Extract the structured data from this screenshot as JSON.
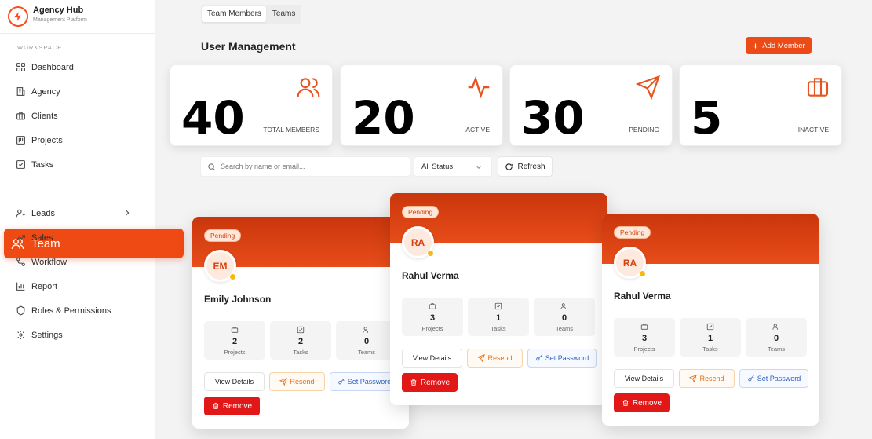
{
  "brand": {
    "name": "Agency Hub",
    "subtitle": "Management Platform"
  },
  "sidebar": {
    "section_label": "WORKSPACE",
    "items": [
      {
        "label": "Dashboard",
        "icon": "grid-icon"
      },
      {
        "label": "Agency",
        "icon": "building-icon"
      },
      {
        "label": "Clients",
        "icon": "briefcase-icon"
      },
      {
        "label": "Projects",
        "icon": "folder-icon"
      },
      {
        "label": "Tasks",
        "icon": "checkbox-icon"
      },
      {
        "label": "Team",
        "icon": "users-icon",
        "active": true
      },
      {
        "label": "Leads",
        "icon": "user-plus-icon",
        "has_chevron": true
      },
      {
        "label": "Sales",
        "icon": "trending-up-icon"
      },
      {
        "label": "Workflow",
        "icon": "workflow-icon"
      },
      {
        "label": "Report",
        "icon": "bar-chart-icon"
      },
      {
        "label": "Roles & Permissions",
        "icon": "shield-icon"
      },
      {
        "label": "Settings",
        "icon": "gear-icon"
      }
    ]
  },
  "tabs": [
    {
      "label": "Team Members",
      "selected": true
    },
    {
      "label": "Teams",
      "selected": false
    }
  ],
  "page_title": "User Management",
  "add_member_label": "Add Member",
  "stats": [
    {
      "value": "40",
      "label": "TOTAL MEMBERS",
      "icon": "users-icon"
    },
    {
      "value": "20",
      "label": "ACTIVE",
      "icon": "activity-icon"
    },
    {
      "value": "30",
      "label": "PENDING",
      "icon": "send-icon"
    },
    {
      "value": "5",
      "label": "INACTIVE",
      "icon": "briefcase-icon"
    }
  ],
  "filters": {
    "search_placeholder": "Search by name or email...",
    "status_value": "All Status",
    "refresh_label": "Refresh"
  },
  "cards": [
    {
      "status": "Pending",
      "initials": "EM",
      "name": "Emily Johnson",
      "metrics": [
        {
          "value": "2",
          "label": "Projects"
        },
        {
          "value": "2",
          "label": "Tasks"
        },
        {
          "value": "0",
          "label": "Teams"
        }
      ],
      "actions": {
        "view": "View Details",
        "resend": "Resend",
        "set_password": "Set Password",
        "remove": "Remove"
      }
    },
    {
      "status": "Pending",
      "initials": "RA",
      "name": "Rahul Verma",
      "metrics": [
        {
          "value": "3",
          "label": "Projects"
        },
        {
          "value": "1",
          "label": "Tasks"
        },
        {
          "value": "0",
          "label": "Teams"
        }
      ],
      "actions": {
        "view": "View Details",
        "resend": "Resend",
        "set_password": "Set Password",
        "remove": "Remove"
      }
    },
    {
      "status": "Pending",
      "initials": "RA",
      "name": "Rahul Verma",
      "metrics": [
        {
          "value": "3",
          "label": "Projects"
        },
        {
          "value": "1",
          "label": "Tasks"
        },
        {
          "value": "0",
          "label": "Teams"
        }
      ],
      "actions": {
        "view": "View Details",
        "resend": "Resend",
        "set_password": "Set Password",
        "remove": "Remove"
      }
    }
  ],
  "colors": {
    "accent": "#f04a14",
    "remove": "#e21717",
    "pending_dot": "#f7b90f"
  }
}
